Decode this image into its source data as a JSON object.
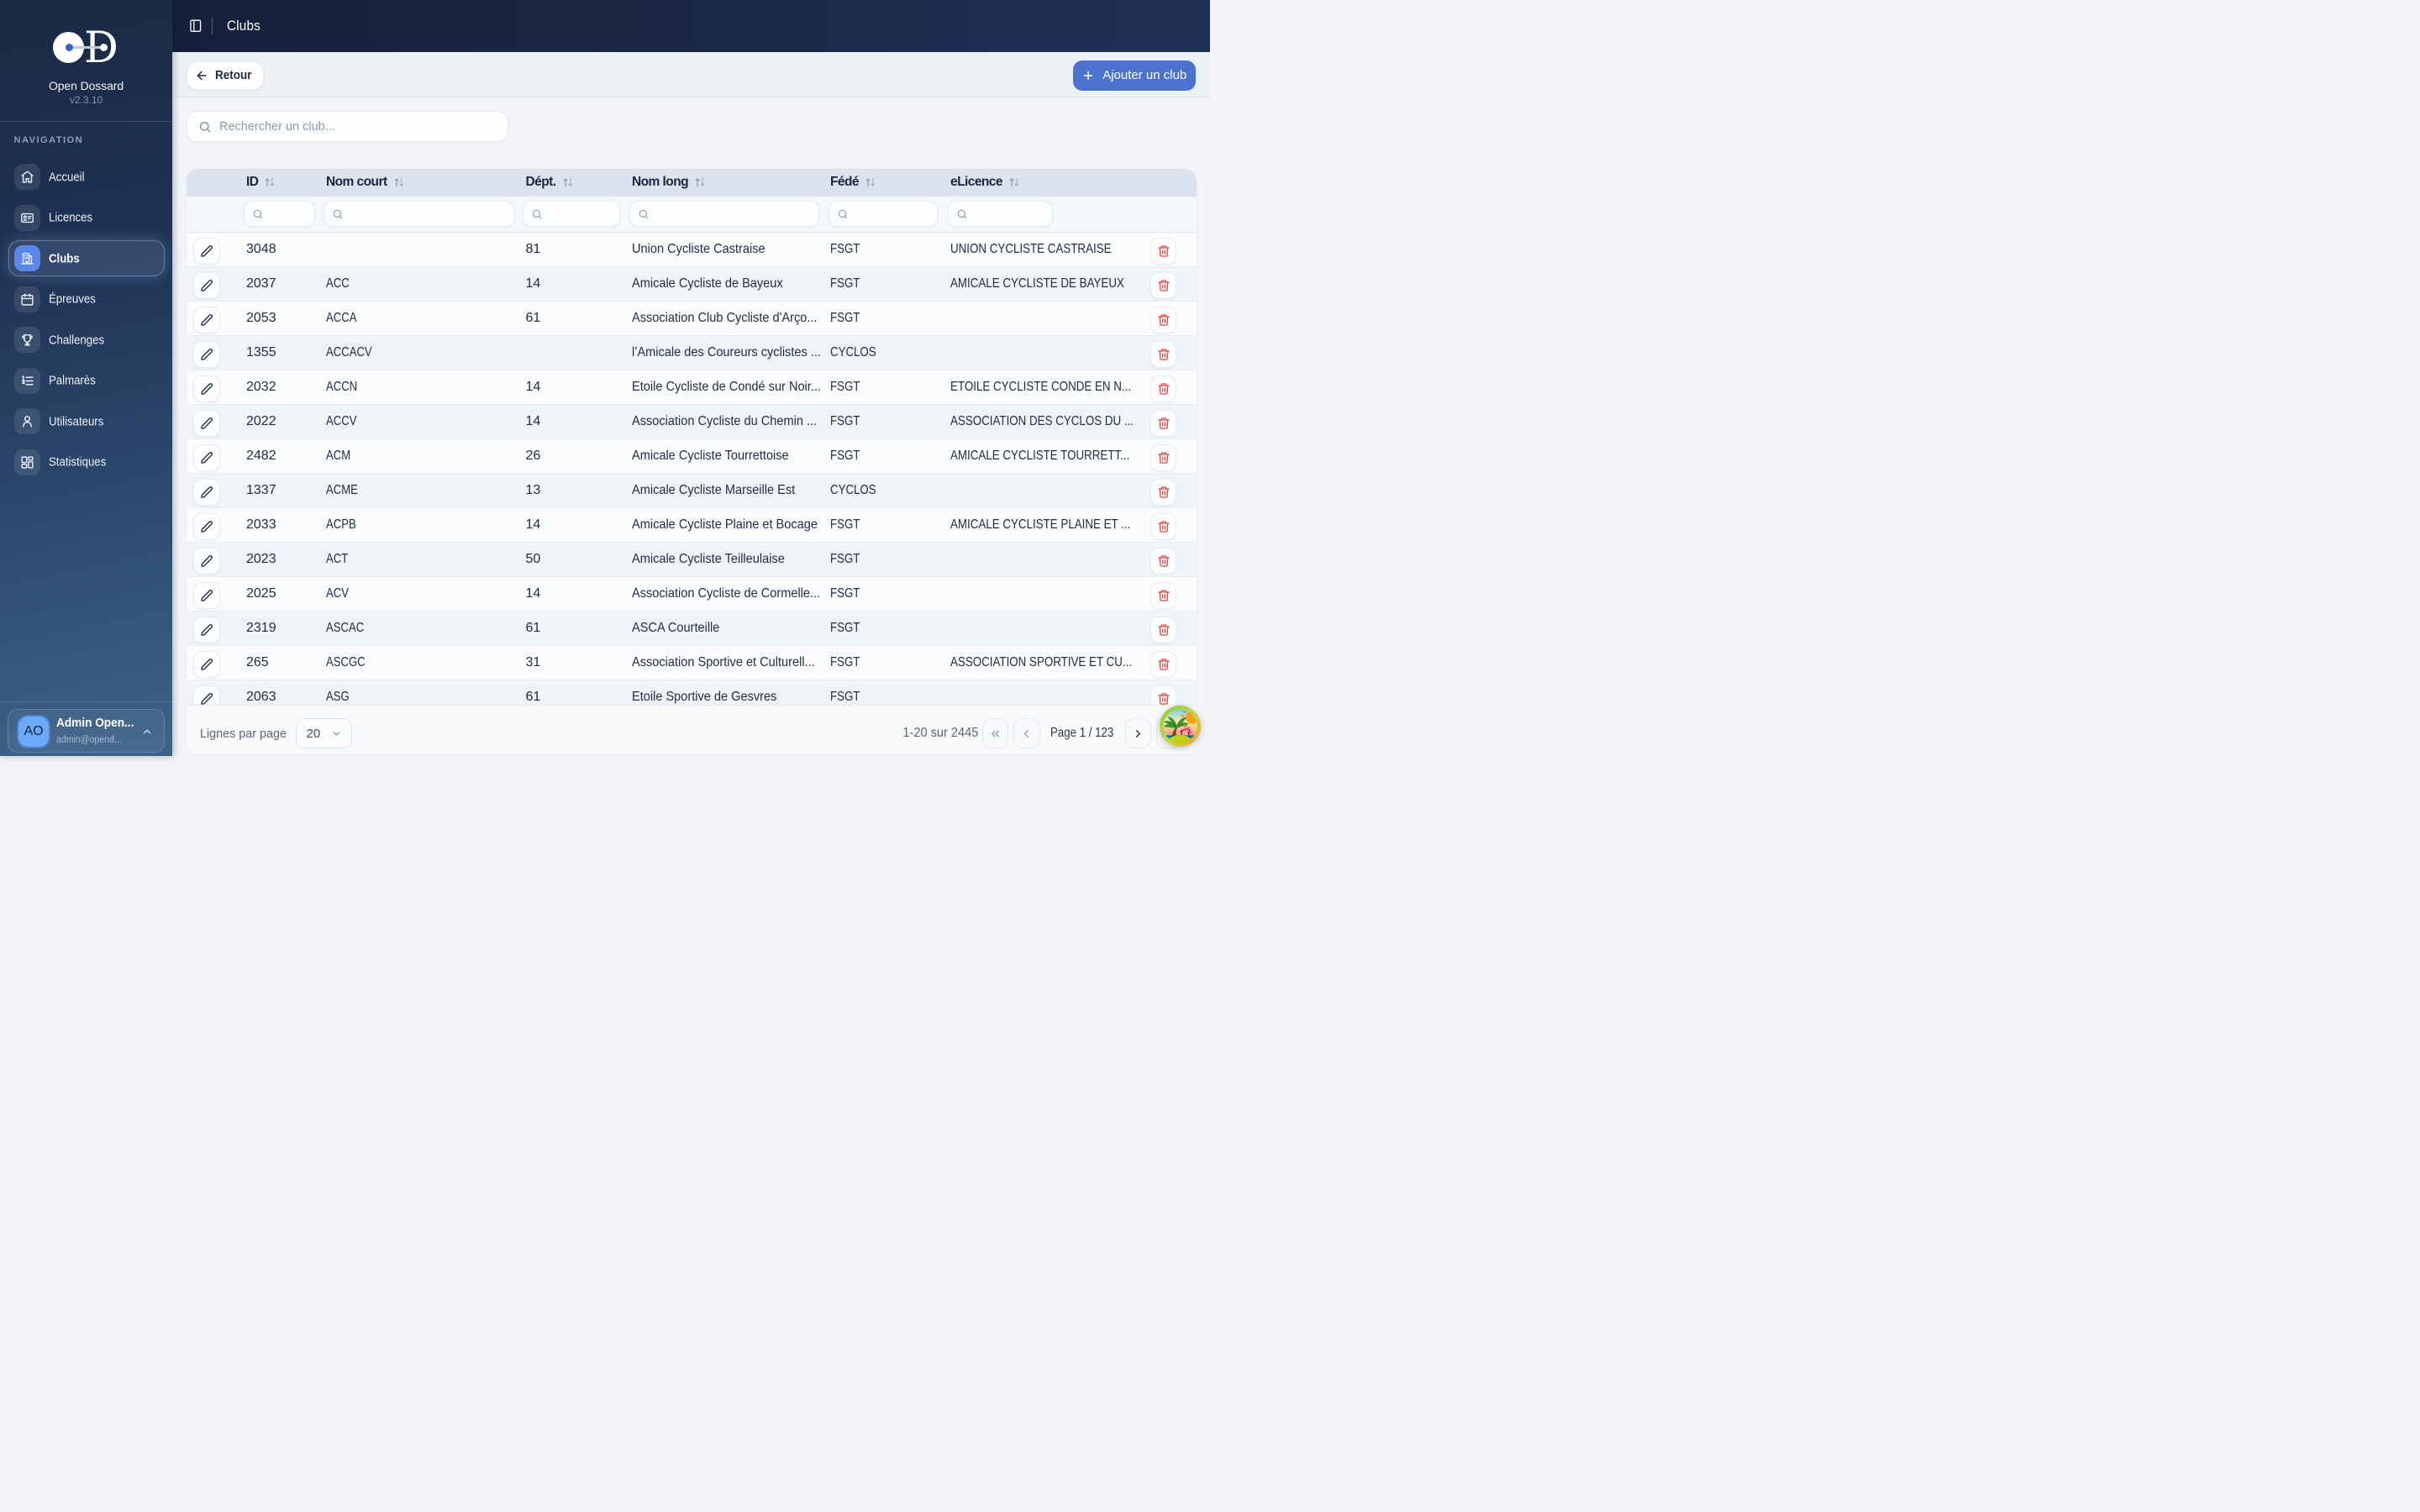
{
  "app": {
    "name": "Open Dossard",
    "version": "v2.3.10"
  },
  "sidebar": {
    "section_label": "NAVIGATION",
    "items": [
      {
        "label": "Accueil",
        "icon": "home-icon",
        "active": false
      },
      {
        "label": "Licences",
        "icon": "id-card-icon",
        "active": false
      },
      {
        "label": "Clubs",
        "icon": "building-icon",
        "active": true
      },
      {
        "label": "Épreuves",
        "icon": "calendar-icon",
        "active": false
      },
      {
        "label": "Challenges",
        "icon": "trophy-icon",
        "active": false
      },
      {
        "label": "Palmarès",
        "icon": "list-ordered-icon",
        "active": false
      },
      {
        "label": "Utilisateurs",
        "icon": "user-icon",
        "active": false
      },
      {
        "label": "Statistiques",
        "icon": "layout-dashboard-icon",
        "active": false
      }
    ],
    "user": {
      "initials": "AO",
      "name": "Admin Open...",
      "email": "admin@opend..."
    }
  },
  "header": {
    "title": "Clubs"
  },
  "toolbar": {
    "back_label": "Retour",
    "add_label": "Ajouter un club"
  },
  "search": {
    "placeholder": "Rechercher un club..."
  },
  "table": {
    "columns": [
      {
        "key": "id",
        "label": "ID"
      },
      {
        "key": "nom_court",
        "label": "Nom court"
      },
      {
        "key": "dept",
        "label": "Dépt."
      },
      {
        "key": "nom_long",
        "label": "Nom long"
      },
      {
        "key": "fede",
        "label": "Fédé"
      },
      {
        "key": "elicence",
        "label": "eLicence"
      }
    ],
    "rows": [
      {
        "id": "3048",
        "nom_court": "",
        "dept": "81",
        "nom_long": "Union Cycliste Castraise",
        "fede": "FSGT",
        "elicence": "UNION CYCLISTE CASTRAISE"
      },
      {
        "id": "2037",
        "nom_court": "ACC",
        "dept": "14",
        "nom_long": "Amicale Cycliste de Bayeux",
        "fede": "FSGT",
        "elicence": "AMICALE CYCLISTE DE BAYEUX"
      },
      {
        "id": "2053",
        "nom_court": "ACCA",
        "dept": "61",
        "nom_long": "Association Club Cycliste d'Arço...",
        "fede": "FSGT",
        "elicence": ""
      },
      {
        "id": "1355",
        "nom_court": "ACCACV",
        "dept": "",
        "nom_long": "l’Amicale des Coureurs cyclistes ...",
        "fede": "CYCLOS",
        "elicence": ""
      },
      {
        "id": "2032",
        "nom_court": "ACCN",
        "dept": "14",
        "nom_long": "Etoile Cycliste de Condé sur Noir...",
        "fede": "FSGT",
        "elicence": "ETOILE CYCLISTE CONDE EN N..."
      },
      {
        "id": "2022",
        "nom_court": "ACCV",
        "dept": "14",
        "nom_long": "Association Cycliste du Chemin ...",
        "fede": "FSGT",
        "elicence": "ASSOCIATION DES CYCLOS DU ..."
      },
      {
        "id": "2482",
        "nom_court": "ACM",
        "dept": "26",
        "nom_long": "Amicale Cycliste Tourrettoise",
        "fede": "FSGT",
        "elicence": "AMICALE CYCLISTE TOURRETT..."
      },
      {
        "id": "1337",
        "nom_court": "ACME",
        "dept": "13",
        "nom_long": "Amicale Cycliste Marseille Est",
        "fede": "CYCLOS",
        "elicence": ""
      },
      {
        "id": "2033",
        "nom_court": "ACPB",
        "dept": "14",
        "nom_long": "Amicale Cycliste Plaine et Bocage",
        "fede": "FSGT",
        "elicence": "AMICALE CYCLISTE PLAINE ET ..."
      },
      {
        "id": "2023",
        "nom_court": "ACT",
        "dept": "50",
        "nom_long": "Amicale Cycliste Teilleulaise",
        "fede": "FSGT",
        "elicence": ""
      },
      {
        "id": "2025",
        "nom_court": "ACV",
        "dept": "14",
        "nom_long": "Association Cycliste de Cormelle...",
        "fede": "FSGT",
        "elicence": ""
      },
      {
        "id": "2319",
        "nom_court": "ASCAC",
        "dept": "61",
        "nom_long": "ASCA Courteille",
        "fede": "FSGT",
        "elicence": ""
      },
      {
        "id": "265",
        "nom_court": "ASCGC",
        "dept": "31",
        "nom_long": "Association Sportive et Culturell...",
        "fede": "FSGT",
        "elicence": "ASSOCIATION SPORTIVE ET CU..."
      },
      {
        "id": "2063",
        "nom_court": "ASG",
        "dept": "61",
        "nom_long": "Etoile Sportive de Gesvres",
        "fede": "FSGT",
        "elicence": ""
      }
    ]
  },
  "pagination": {
    "rows_per_page_label": "Lignes par page",
    "rows_per_page": "20",
    "range_label": "1-20 sur 2445",
    "page_label": "Page 1 / 123"
  },
  "colors": {
    "accent_blue": "#4b73cd",
    "active_icon_blue": "#5b87ea",
    "avatar_blue": "#6ea8f8",
    "logo_dot_blue": "#3a5fc5",
    "danger_red": "#e0473f",
    "table_header_bg": "#dce3ef",
    "sidebar_top": "#1a2944",
    "sidebar_bottom": "#3e6389"
  }
}
